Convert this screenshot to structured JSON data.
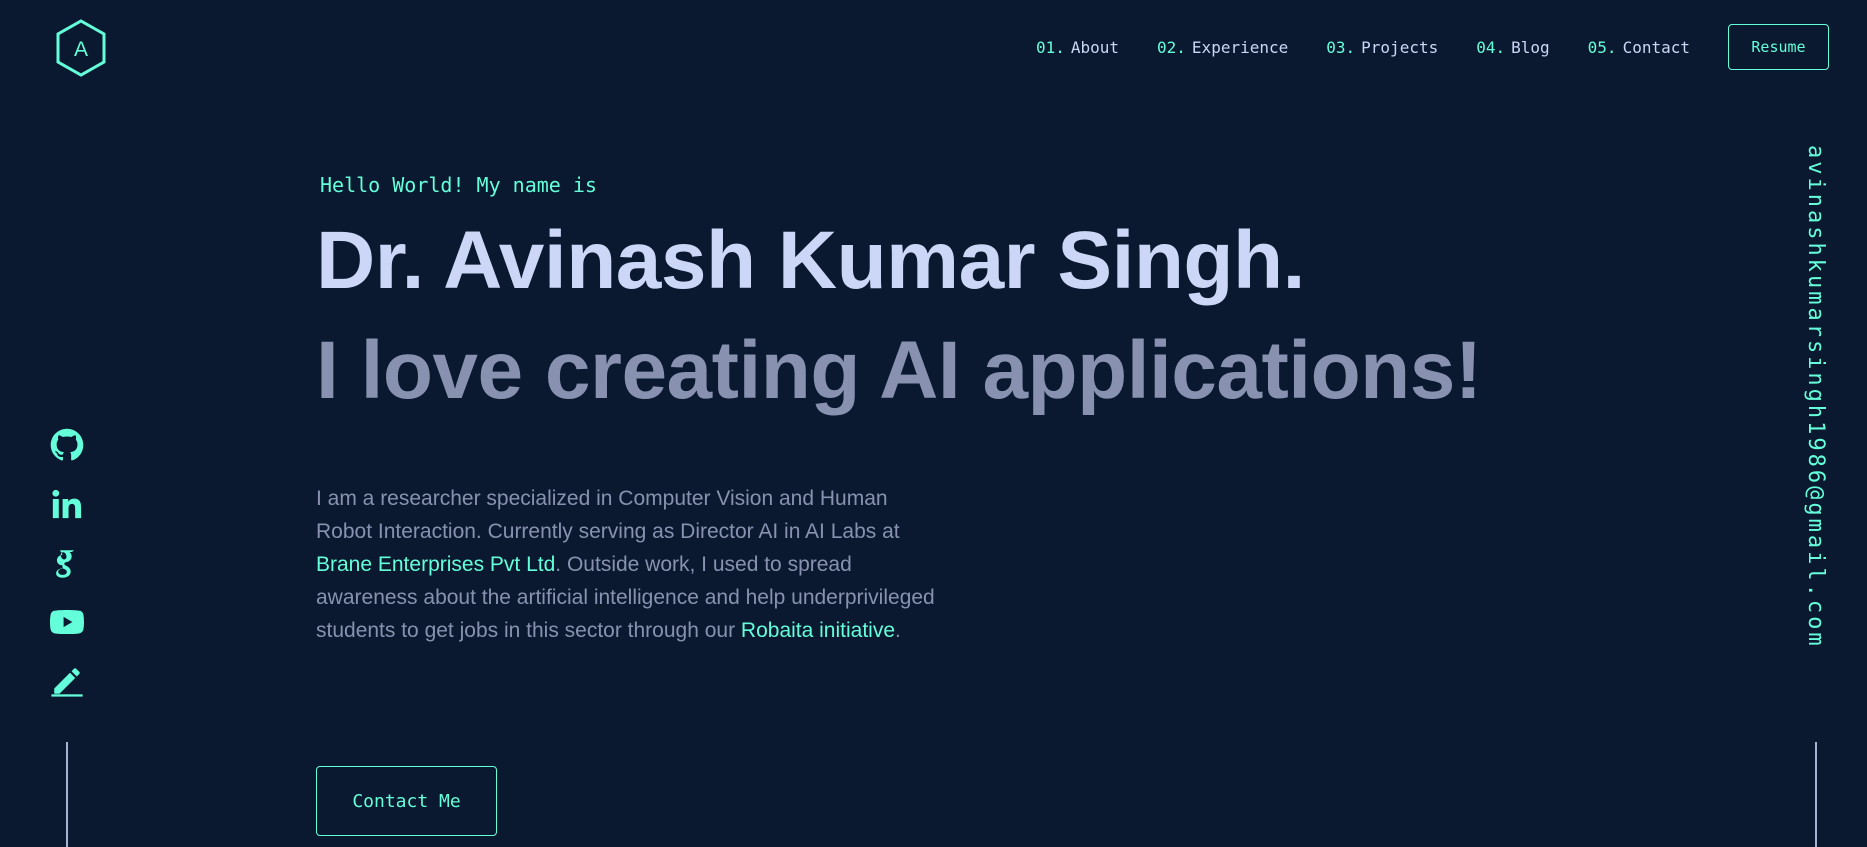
{
  "header": {
    "logo_letter": "A",
    "nav": [
      {
        "num": "01.",
        "label": "About"
      },
      {
        "num": "02.",
        "label": "Experience"
      },
      {
        "num": "03.",
        "label": "Projects"
      },
      {
        "num": "04.",
        "label": "Blog"
      },
      {
        "num": "05.",
        "label": "Contact"
      }
    ],
    "resume_label": "Resume"
  },
  "hero": {
    "greeting": "Hello World! My name is",
    "name": "Dr. Avinash Kumar Singh.",
    "tagline": "I love creating AI applications!",
    "bio": {
      "part1": "I am a researcher specialized in Computer Vision and Human Robot Interaction. Currently serving as Director AI in AI Labs at ",
      "link1": "Brane Enterprises Pvt Ltd",
      "part2": ". Outside work, I used to spread awareness about the artificial intelligence and help underprivileged students to get jobs in this sector through our ",
      "link2": "Robaita initiative",
      "part3": "."
    },
    "contact_label": "Contact Me"
  },
  "social": [
    "github-icon",
    "linkedin-icon",
    "google-scholar-icon",
    "youtube-icon",
    "pencil-icon"
  ],
  "email": "avinashkumarsingh1986@gmail.com",
  "colors": {
    "background": "#0a192f",
    "accent": "#64ffda",
    "heading": "#ccd6f6",
    "text": "#8892b0"
  }
}
